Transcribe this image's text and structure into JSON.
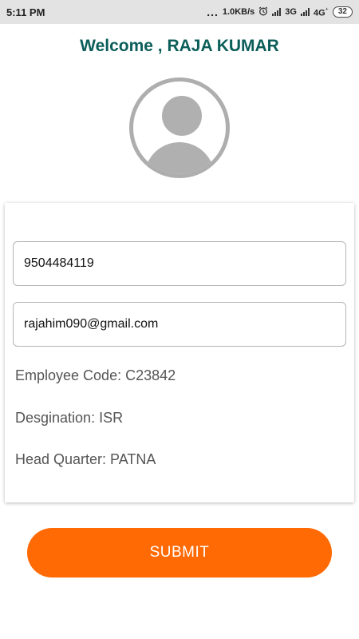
{
  "status_bar": {
    "time": "5:11 PM",
    "overflow_dots": "...",
    "net_speed": "1.0KB/s",
    "alarm_icon": "alarm-clock-icon",
    "network_1": "3G",
    "network_2": "4G",
    "network_2_sub": "⁺",
    "battery": "32"
  },
  "header": {
    "welcome_text": "Welcome , RAJA KUMAR"
  },
  "profile": {
    "avatar_icon": "user-placeholder-icon"
  },
  "form": {
    "phone_value": "9504484119",
    "email_value": "rajahim090@gmail.com",
    "employee_code": "Employee Code: C23842",
    "designation": "Desgination: ISR",
    "head_quarter": "Head Quarter: PATNA"
  },
  "actions": {
    "submit_label": "SUBMIT"
  },
  "colors": {
    "accent_text": "#0b5e5a",
    "submit_bg": "#ff6a05",
    "status_bar_bg": "#e3e3e3"
  }
}
